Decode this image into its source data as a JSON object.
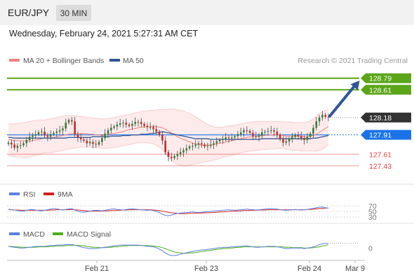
{
  "header": {
    "pair": "EUR/JPY",
    "timeframe": "30 MIN",
    "datetime": "Wednesday, February 24, 2021 5:27:31 AM CET"
  },
  "colors": {
    "bollinger": "#f08080",
    "ma50": "#2f5597",
    "resistance": "#5aa618",
    "pivot": "#1a73e8",
    "current": "#333333",
    "support": "#e84040",
    "rsi": "#5b7fe0",
    "rsi_ma": "#d32020",
    "macd": "#5b7fe0",
    "macd_signal": "#4caf1a",
    "candle_up": "#2e7d32",
    "candle_down": "#c62828",
    "arrow": "#2f5597"
  },
  "chart_data": [
    {
      "type": "line",
      "panel": "price",
      "legend": [
        {
          "label": "MA 20 + Bollinger Bands",
          "color_key": "bollinger"
        },
        {
          "label": "MA 50",
          "color_key": "ma50"
        }
      ],
      "credit": "Research © 2021 Trading Central",
      "x_ticks": [
        "Feb 21",
        "Feb 23",
        "Feb 24",
        "Mar 9"
      ],
      "ylim": [
        127.2,
        128.95
      ],
      "levels": [
        {
          "value": "128.79",
          "kind": "resistance"
        },
        {
          "value": "128.61",
          "kind": "resistance"
        },
        {
          "value": "128.18",
          "kind": "current"
        },
        {
          "value": "127.91",
          "kind": "pivot"
        },
        {
          "value": "127.61",
          "kind": "support"
        },
        {
          "value": "127.43",
          "kind": "support"
        }
      ],
      "close": [
        127.79,
        127.76,
        127.71,
        127.74,
        127.75,
        127.78,
        127.83,
        127.88,
        127.9,
        127.92,
        127.95,
        127.96,
        127.9,
        127.88,
        127.92,
        127.94,
        127.96,
        127.98,
        128.01,
        128.1,
        128.14,
        128.12,
        127.92,
        127.87,
        127.84,
        127.82,
        127.78,
        127.8,
        127.77,
        127.76,
        127.8,
        127.86,
        127.93,
        127.98,
        128.02,
        128.04,
        128.07,
        128.09,
        128.1,
        128.07,
        128.05,
        128.08,
        128.11,
        128.11,
        128.08,
        128.05,
        128.03,
        128.03,
        128.0,
        127.96,
        127.91,
        127.82,
        127.64,
        127.57,
        127.55,
        127.58,
        127.61,
        127.64,
        127.67,
        127.7,
        127.73,
        127.74,
        127.76,
        127.78,
        127.76,
        127.73,
        127.74,
        127.76,
        127.78,
        127.81,
        127.83,
        127.85,
        127.87,
        127.86,
        127.87,
        127.89,
        127.92,
        127.95,
        127.98,
        127.97,
        127.94,
        127.89,
        127.88,
        127.9,
        127.95,
        127.96,
        127.97,
        127.98,
        127.96,
        127.91,
        127.84,
        127.79,
        127.81,
        127.84,
        127.88,
        127.91,
        127.89,
        127.86,
        127.83,
        127.88,
        127.93,
        128.02,
        128.12,
        128.18,
        128.22,
        128.19,
        128.18
      ],
      "ma20": [
        127.84,
        127.83,
        127.82,
        127.82,
        127.82,
        127.82,
        127.82,
        127.82,
        127.82,
        127.83,
        127.84,
        127.85,
        127.86,
        127.86,
        127.86,
        127.87,
        127.88,
        127.89,
        127.9,
        127.91,
        127.92,
        127.93,
        127.93,
        127.93,
        127.93,
        127.93,
        127.93,
        127.92,
        127.92,
        127.91,
        127.91,
        127.9,
        127.91,
        127.92,
        127.93,
        127.93,
        127.94,
        127.95,
        127.96,
        127.98,
        127.99,
        128.0,
        128.01,
        128.02,
        128.03,
        128.03,
        128.04,
        128.04,
        128.04,
        128.04,
        128.03,
        128.02,
        128.0,
        127.97,
        127.94,
        127.91,
        127.88,
        127.86,
        127.84,
        127.82,
        127.8,
        127.78,
        127.77,
        127.76,
        127.75,
        127.75,
        127.75,
        127.75,
        127.76,
        127.77,
        127.78,
        127.79,
        127.8,
        127.81,
        127.82,
        127.83,
        127.84,
        127.85,
        127.86,
        127.87,
        127.88,
        127.88,
        127.89,
        127.89,
        127.9,
        127.9,
        127.91,
        127.91,
        127.91,
        127.91,
        127.91,
        127.9,
        127.89,
        127.89,
        127.89,
        127.89,
        127.89,
        127.88,
        127.88,
        127.88,
        127.89,
        127.9,
        127.92,
        127.95,
        127.98,
        128.01,
        128.04
      ],
      "bb_upper": [
        128.08,
        128.08,
        128.08,
        128.09,
        128.09,
        128.1,
        128.11,
        128.12,
        128.13,
        128.13,
        128.14,
        128.14,
        128.14,
        128.15,
        128.16,
        128.17,
        128.18,
        128.19,
        128.2,
        128.21,
        128.21,
        128.21,
        128.21,
        128.2,
        128.2,
        128.19,
        128.18,
        128.18,
        128.17,
        128.17,
        128.16,
        128.16,
        128.16,
        128.17,
        128.17,
        128.18,
        128.19,
        128.2,
        128.21,
        128.22,
        128.23,
        128.24,
        128.25,
        128.26,
        128.27,
        128.28,
        128.28,
        128.29,
        128.29,
        128.3,
        128.3,
        128.3,
        128.3,
        128.31,
        128.31,
        128.31,
        128.3,
        128.29,
        128.28,
        128.26,
        128.24,
        128.22,
        128.19,
        128.16,
        128.13,
        128.1,
        128.07,
        128.05,
        128.04,
        128.03,
        128.03,
        128.03,
        128.04,
        128.05,
        128.05,
        128.06,
        128.07,
        128.08,
        128.09,
        128.1,
        128.11,
        128.11,
        128.12,
        128.12,
        128.12,
        128.12,
        128.12,
        128.12,
        128.12,
        128.12,
        128.12,
        128.11,
        128.11,
        128.11,
        128.11,
        128.1,
        128.1,
        128.1,
        128.1,
        128.11,
        128.13,
        128.16,
        128.2,
        128.24,
        128.27,
        128.29,
        128.3
      ],
      "bb_lower": [
        127.58,
        127.58,
        127.57,
        127.57,
        127.57,
        127.56,
        127.56,
        127.57,
        127.58,
        127.59,
        127.6,
        127.62,
        127.63,
        127.63,
        127.63,
        127.64,
        127.65,
        127.66,
        127.67,
        127.68,
        127.69,
        127.7,
        127.71,
        127.71,
        127.72,
        127.72,
        127.72,
        127.72,
        127.72,
        127.71,
        127.71,
        127.7,
        127.7,
        127.7,
        127.71,
        127.71,
        127.72,
        127.73,
        127.74,
        127.75,
        127.76,
        127.77,
        127.78,
        127.79,
        127.79,
        127.79,
        127.79,
        127.78,
        127.77,
        127.75,
        127.72,
        127.68,
        127.62,
        127.56,
        127.51,
        127.47,
        127.45,
        127.44,
        127.43,
        127.43,
        127.44,
        127.45,
        127.46,
        127.47,
        127.48,
        127.49,
        127.5,
        127.51,
        127.52,
        127.53,
        127.54,
        127.56,
        127.57,
        127.58,
        127.59,
        127.6,
        127.62,
        127.63,
        127.64,
        127.65,
        127.66,
        127.66,
        127.67,
        127.67,
        127.68,
        127.68,
        127.69,
        127.69,
        127.69,
        127.7,
        127.7,
        127.7,
        127.69,
        127.68,
        127.67,
        127.67,
        127.67,
        127.66,
        127.66,
        127.66,
        127.66,
        127.66,
        127.66,
        127.67,
        127.69,
        127.72,
        127.76
      ],
      "ma50": [
        127.87,
        127.87,
        127.86,
        127.86,
        127.86,
        127.86,
        127.86,
        127.86,
        127.86,
        127.86,
        127.86,
        127.86,
        127.86,
        127.86,
        127.86,
        127.86,
        127.86,
        127.86,
        127.86,
        127.86,
        127.87,
        127.87,
        127.87,
        127.87,
        127.87,
        127.87,
        127.87,
        127.87,
        127.88,
        127.88,
        127.88,
        127.88,
        127.88,
        127.88,
        127.89,
        127.89,
        127.89,
        127.89,
        127.9,
        127.9,
        127.9,
        127.91,
        127.91,
        127.91,
        127.92,
        127.92,
        127.92,
        127.93,
        127.93,
        127.94,
        127.95,
        127.96,
        127.95,
        127.94,
        127.93,
        127.92,
        127.91,
        127.9,
        127.89,
        127.88,
        127.87,
        127.86,
        127.85,
        127.85,
        127.85,
        127.85,
        127.85,
        127.84,
        127.84,
        127.84,
        127.84,
        127.84,
        127.84,
        127.84,
        127.84,
        127.84,
        127.84,
        127.84,
        127.84,
        127.84,
        127.84,
        127.84,
        127.84,
        127.84,
        127.85,
        127.85,
        127.85,
        127.85,
        127.85,
        127.85,
        127.85,
        127.85,
        127.85,
        127.85,
        127.85,
        127.85,
        127.85,
        127.85,
        127.85,
        127.85,
        127.85,
        127.86,
        127.86,
        127.87,
        127.88,
        127.89,
        127.9
      ],
      "forecast_target": 128.72
    },
    {
      "type": "line",
      "panel": "rsi",
      "legend": [
        {
          "label": "RSI",
          "color_key": "rsi"
        },
        {
          "label": "9MA",
          "color_key": "rsi_ma"
        }
      ],
      "levels": [
        "70",
        "50",
        "30"
      ],
      "ylim": [
        20,
        80
      ],
      "rsi": [
        58,
        56,
        55,
        53,
        52,
        51,
        54,
        56,
        57,
        55,
        53,
        52,
        54,
        56,
        58,
        60,
        59,
        57,
        55,
        57,
        59,
        60,
        55,
        50,
        48,
        47,
        49,
        51,
        53,
        54,
        53,
        52,
        54,
        56,
        58,
        59,
        57,
        56,
        55,
        57,
        58,
        59,
        58,
        57,
        56,
        55,
        54,
        55,
        53,
        50,
        46,
        40,
        36,
        35,
        37,
        40,
        43,
        44,
        45,
        46,
        47,
        48,
        47,
        46,
        47,
        48,
        49,
        50,
        51,
        52,
        53,
        54,
        55,
        56,
        55,
        54,
        55,
        56,
        57,
        58,
        57,
        56,
        55,
        56,
        57,
        58,
        59,
        60,
        59,
        58,
        56,
        55,
        54,
        55,
        56,
        57,
        56,
        55,
        56,
        57,
        59,
        61,
        63,
        65,
        66,
        63,
        62
      ],
      "rsi_ma": [
        57,
        56,
        55,
        55,
        54,
        54,
        54,
        54,
        54,
        54,
        54,
        54,
        54,
        54,
        55,
        55,
        56,
        56,
        56,
        56,
        56,
        57,
        56,
        55,
        54,
        53,
        52,
        51,
        51,
        51,
        51,
        51,
        52,
        52,
        53,
        53,
        54,
        54,
        55,
        55,
        56,
        56,
        56,
        56,
        56,
        56,
        56,
        56,
        55,
        54,
        53,
        51,
        49,
        47,
        45,
        44,
        43,
        42,
        42,
        42,
        43,
        43,
        44,
        44,
        44,
        45,
        45,
        46,
        46,
        47,
        48,
        48,
        49,
        50,
        51,
        51,
        52,
        52,
        53,
        53,
        54,
        54,
        54,
        55,
        55,
        55,
        56,
        56,
        56,
        56,
        56,
        56,
        56,
        56,
        56,
        56,
        56,
        56,
        56,
        57,
        57,
        58,
        59,
        60,
        61,
        62,
        62
      ]
    },
    {
      "type": "line",
      "panel": "macd",
      "legend": [
        {
          "label": "MACD",
          "color_key": "macd"
        },
        {
          "label": "MACD Signal",
          "color_key": "macd_signal"
        }
      ],
      "levels": [
        "0"
      ],
      "ylim": [
        -0.25,
        0.2
      ],
      "macd": [
        0.04,
        0.03,
        0.02,
        0.01,
        0.0,
        0.0,
        0.01,
        0.02,
        0.03,
        0.04,
        0.04,
        0.04,
        0.04,
        0.05,
        0.06,
        0.06,
        0.07,
        0.07,
        0.07,
        0.08,
        0.08,
        0.08,
        0.07,
        0.05,
        0.03,
        0.01,
        0.0,
        -0.01,
        -0.01,
        -0.01,
        0.0,
        0.01,
        0.02,
        0.03,
        0.04,
        0.05,
        0.06,
        0.07,
        0.07,
        0.07,
        0.07,
        0.07,
        0.07,
        0.07,
        0.06,
        0.05,
        0.04,
        0.04,
        0.03,
        0.01,
        -0.02,
        -0.06,
        -0.11,
        -0.15,
        -0.17,
        -0.17,
        -0.16,
        -0.14,
        -0.12,
        -0.11,
        -0.09,
        -0.08,
        -0.06,
        -0.05,
        -0.04,
        -0.04,
        -0.03,
        -0.02,
        -0.01,
        0.0,
        0.01,
        0.01,
        0.02,
        0.02,
        0.03,
        0.03,
        0.04,
        0.04,
        0.05,
        0.05,
        0.04,
        0.03,
        0.02,
        0.02,
        0.03,
        0.03,
        0.04,
        0.04,
        0.04,
        0.03,
        0.02,
        0.0,
        -0.01,
        -0.01,
        0.0,
        0.0,
        0.0,
        0.0,
        -0.01,
        0.0,
        0.01,
        0.03,
        0.05,
        0.08,
        0.1,
        0.11,
        0.11
      ],
      "macd_signal": [
        0.04,
        0.04,
        0.03,
        0.03,
        0.02,
        0.02,
        0.02,
        0.02,
        0.02,
        0.02,
        0.03,
        0.03,
        0.03,
        0.03,
        0.04,
        0.04,
        0.05,
        0.05,
        0.05,
        0.06,
        0.06,
        0.06,
        0.07,
        0.06,
        0.06,
        0.05,
        0.04,
        0.03,
        0.02,
        0.02,
        0.01,
        0.01,
        0.01,
        0.02,
        0.02,
        0.03,
        0.03,
        0.04,
        0.05,
        0.05,
        0.06,
        0.06,
        0.06,
        0.06,
        0.06,
        0.06,
        0.06,
        0.05,
        0.05,
        0.04,
        0.03,
        0.01,
        -0.01,
        -0.04,
        -0.06,
        -0.09,
        -0.1,
        -0.11,
        -0.12,
        -0.12,
        -0.11,
        -0.11,
        -0.1,
        -0.09,
        -0.08,
        -0.07,
        -0.06,
        -0.05,
        -0.04,
        -0.03,
        -0.02,
        -0.01,
        -0.01,
        0.0,
        0.0,
        0.01,
        0.02,
        0.02,
        0.03,
        0.03,
        0.03,
        0.03,
        0.03,
        0.03,
        0.03,
        0.03,
        0.03,
        0.03,
        0.03,
        0.03,
        0.03,
        0.03,
        0.02,
        0.02,
        0.01,
        0.01,
        0.01,
        0.01,
        0.0,
        0.0,
        0.0,
        0.01,
        0.02,
        0.03,
        0.05,
        0.06,
        0.08
      ]
    }
  ]
}
